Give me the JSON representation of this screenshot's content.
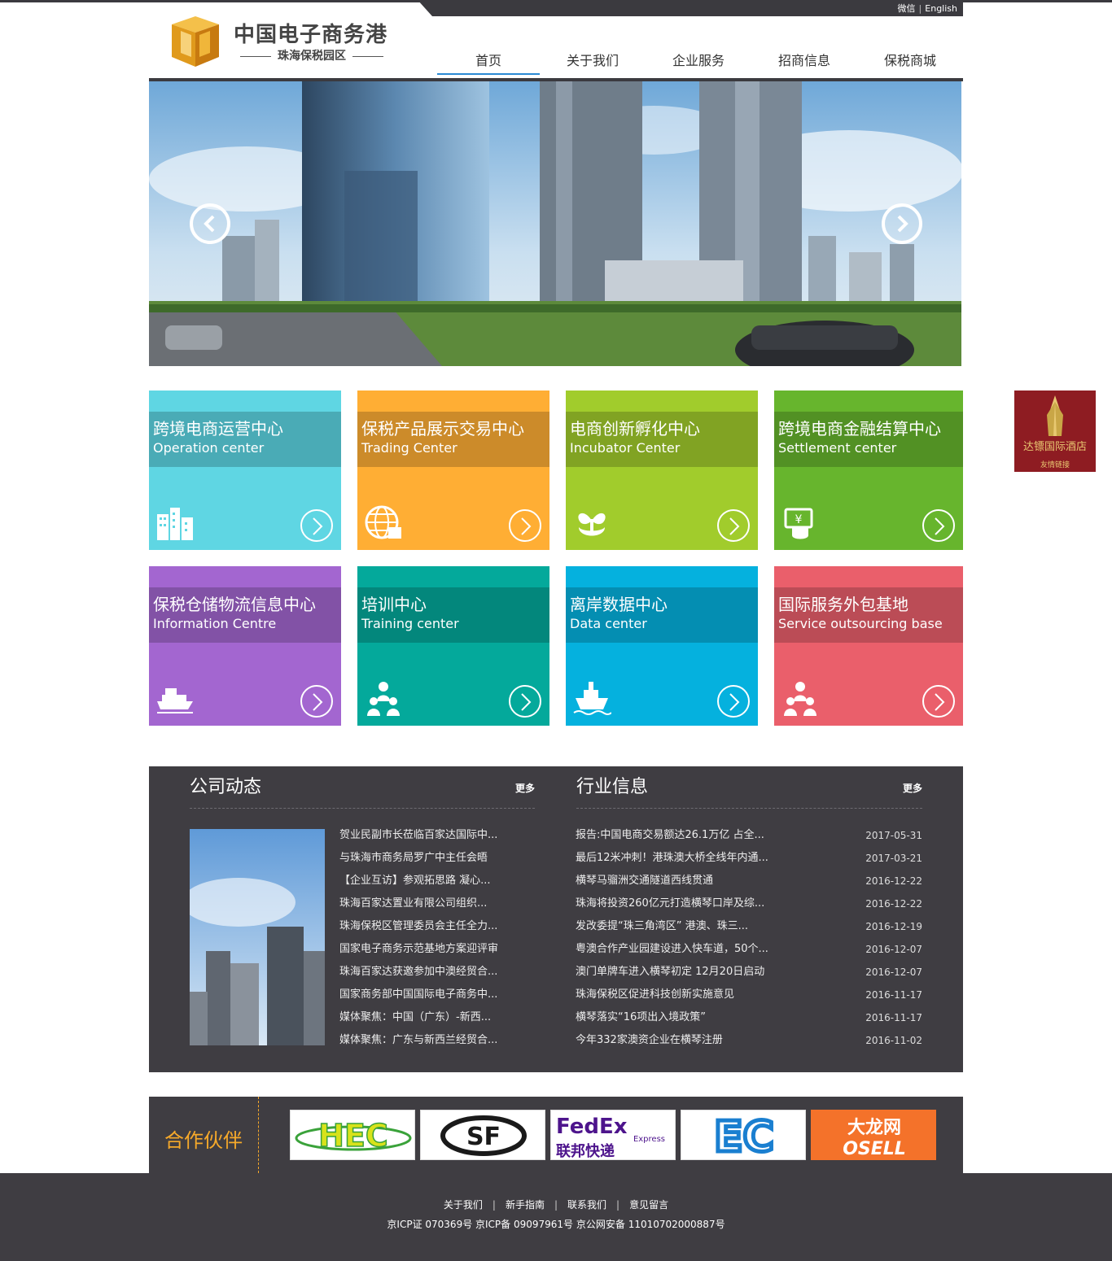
{
  "topbar": {
    "wechat": "微信",
    "separator": "|",
    "english": "English"
  },
  "logo": {
    "title": "中国电子商务港",
    "subtitle": "珠海保税园区"
  },
  "nav": [
    {
      "label": "首页"
    },
    {
      "label": "关于我们"
    },
    {
      "label": "企业服务"
    },
    {
      "label": "招商信息"
    },
    {
      "label": "保税商城"
    }
  ],
  "tiles": [
    {
      "cn": "跨境电商运营中心",
      "en": "Operation center",
      "bg": "#5fd6e3",
      "band": "#4aabb6",
      "icon": "buildings-icon"
    },
    {
      "cn": "保税产品展示交易中心",
      "en": "Trading Center",
      "bg": "#ffae34",
      "band": "#cc8b2a",
      "icon": "globe-icon"
    },
    {
      "cn": "电商创新孵化中心",
      "en": "Incubator Center",
      "bg": "#a1cc2c",
      "band": "#81a323",
      "icon": "sprout-icon"
    },
    {
      "cn": "跨境电商金融结算中心",
      "en": "Settlement center",
      "bg": "#67b52d",
      "band": "#529124",
      "icon": "payment-icon"
    },
    {
      "cn": "保税仓储物流信息中心",
      "en": "Information Centre",
      "bg": "#a366d0",
      "band": "#8252a6",
      "icon": "ship-icon"
    },
    {
      "cn": "培训中心",
      "en": "Training center",
      "bg": "#04a99b",
      "band": "#03877c",
      "icon": "group-icon"
    },
    {
      "cn": "离岸数据中心",
      "en": "Data center",
      "bg": "#05b1de",
      "band": "#048eb2",
      "icon": "cargo-ship-icon"
    },
    {
      "cn": "国际服务外包基地",
      "en": "Service outsourcing base",
      "bg": "#ea5f6b",
      "band": "#bb4c56",
      "icon": "team-icon"
    }
  ],
  "company_news": {
    "title": "公司动态",
    "more": "更多",
    "items": [
      "贺业民副市长莅临百家达国际中...",
      "与珠海市商务局罗广中主任会晤",
      "【企业互访】参观拓思路 凝心...",
      "珠海百家达置业有限公司组织...",
      "珠海保税区管理委员会主任全力...",
      "国家电子商务示范基地方案迎评审",
      "珠海百家达获邀参加中澳经贸合...",
      "国家商务部中国国际电子商务中...",
      "媒体聚焦：中国（广东）-新西...",
      "媒体聚焦：广东与新西兰经贸合..."
    ]
  },
  "industry_news": {
    "title": "行业信息",
    "more": "更多",
    "items": [
      {
        "title": "报告:中国电商交易额达26.1万亿 占全...",
        "date": "2017-05-31"
      },
      {
        "title": "最后12米冲刺！港珠澳大桥全线年内通...",
        "date": "2017-03-21"
      },
      {
        "title": "横琴马骝洲交通隧道西线贯通",
        "date": "2016-12-22"
      },
      {
        "title": "珠海将投资260亿元打造横琴口岸及综...",
        "date": "2016-12-22"
      },
      {
        "title": "发改委提“珠三角湾区” 港澳、珠三...",
        "date": "2016-12-19"
      },
      {
        "title": "粤澳合作产业园建设进入快车道，50个...",
        "date": "2016-12-07"
      },
      {
        "title": "澳门单牌车进入横琴初定 12月20日启动",
        "date": "2016-12-07"
      },
      {
        "title": "珠海保税区促进科技创新实施意见",
        "date": "2016-11-17"
      },
      {
        "title": "横琴落实“16项出入境政策”",
        "date": "2016-11-17"
      },
      {
        "title": "今年332家澳资企业在横琴注册",
        "date": "2016-11-02"
      }
    ]
  },
  "partners": {
    "title": "合作伙伴",
    "logos": [
      {
        "text": "HEC",
        "icon": "hec-logo"
      },
      {
        "text": "SF",
        "icon": "sf-logo"
      },
      {
        "text": "FedEx",
        "sub": "Express",
        "cn": "联邦快递",
        "icon": "fedex-logo"
      },
      {
        "text": "EC",
        "icon": "ec-logo"
      },
      {
        "text": "大龙网",
        "sub": "OSELL",
        "icon": "osell-logo"
      }
    ]
  },
  "footer": {
    "links": [
      "关于我们",
      "新手指南",
      "联系我们",
      "意见留言"
    ],
    "separator": "|",
    "copyright": "京ICP证 070369号 京ICP备 09097961号 京公网安备 11010702000887号"
  },
  "side_ad": {
    "name": "达镖国际酒店",
    "link": "友情链接"
  }
}
